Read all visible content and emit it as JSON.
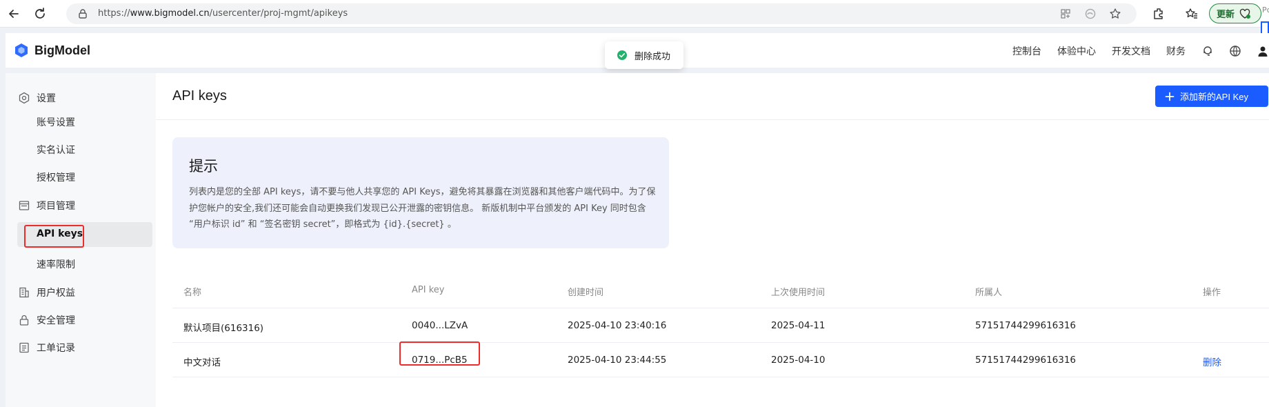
{
  "browser": {
    "url_scheme": "https://",
    "url_host": "www.bigmodel.cn",
    "url_path": "/usercenter/proj-mgmt/apikeys",
    "update_label": "更新",
    "edge_text": "Pc"
  },
  "topnav": {
    "brand": "BigModel",
    "links": [
      "控制台",
      "体验中心",
      "开发文档",
      "财务"
    ]
  },
  "toast": {
    "text": "删除成功"
  },
  "sidebar": {
    "settings": "设置",
    "account": "账号设置",
    "realname": "实名认证",
    "auth": "授权管理",
    "project": "项目管理",
    "apikeys": "API keys",
    "ratelimit": "速率限制",
    "rights": "用户权益",
    "security": "安全管理",
    "tickets": "工单记录"
  },
  "main": {
    "title": "API keys",
    "add_button": "添加新的API Key",
    "tip_title": "提示",
    "tip_body": "列表内是您的全部 API keys，请不要与他人共享您的 API Keys，避免将其暴露在浏览器和其他客户端代码中。为了保护您帐户的安全,我们还可能会自动更换我们发现已公开泄露的密钥信息。 新版机制中平台颁发的 API Key 同时包含 “用户标识 id” 和 “签名密钥 secret”，即格式为 {id}.{secret} 。"
  },
  "table": {
    "headers": [
      "名称",
      "API key",
      "创建时间",
      "上次使用时间",
      "所属人",
      "操作"
    ],
    "rows": [
      {
        "name": "默认项目(616316)",
        "key": "0040...LZvA",
        "created": "2025-04-10 23:40:16",
        "last_used": "2025-04-11",
        "owner": "57151744299616316",
        "action": ""
      },
      {
        "name": "中文对话",
        "key": "0719...PcB5",
        "created": "2025-04-10 23:44:55",
        "last_used": "2025-04-10",
        "owner": "57151744299616316",
        "action": "删除"
      }
    ]
  },
  "colors": {
    "accent": "#1a5cff",
    "highlight": "#ee2a2a",
    "success": "#1e8e3e"
  }
}
